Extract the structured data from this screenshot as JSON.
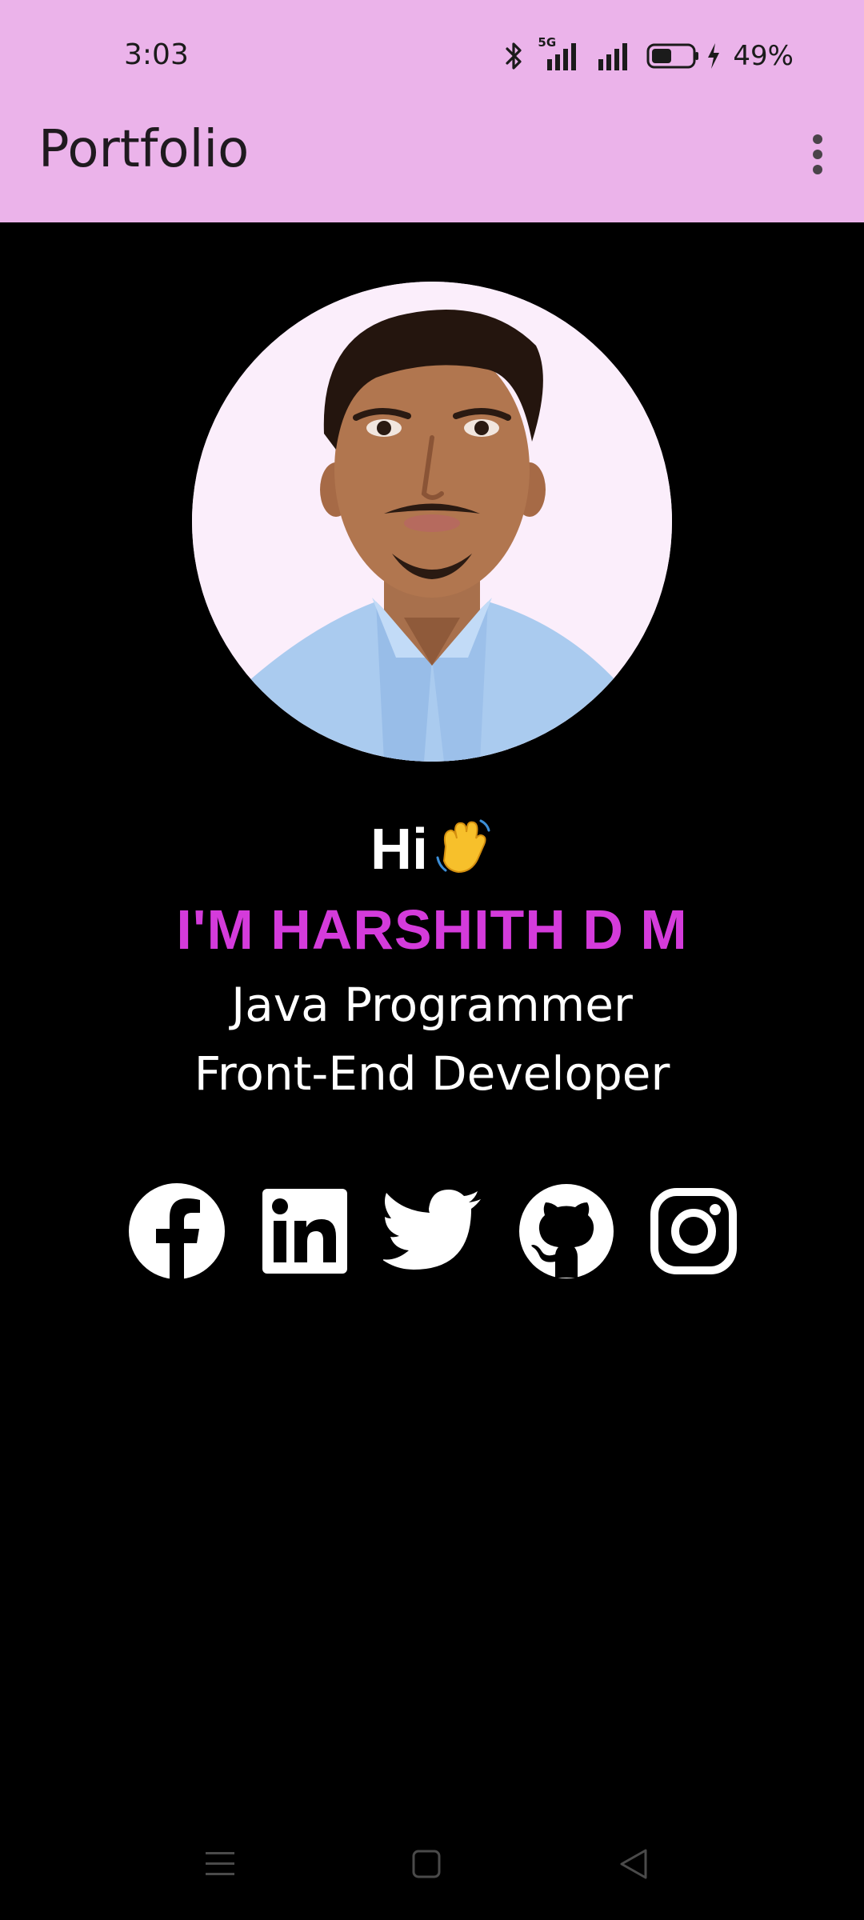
{
  "status_bar": {
    "time": "3:03",
    "battery_percent": "49%",
    "network_label": "5G",
    "battery_level": 0.49,
    "icons": [
      "bluetooth-icon",
      "signal-5g-icon",
      "signal-icon",
      "battery-icon",
      "charging-icon"
    ]
  },
  "app_bar": {
    "title": "Portfolio",
    "menu_icon": "more-vert-icon"
  },
  "profile": {
    "greeting": "Hi",
    "greeting_emoji": "waving-hand-icon",
    "name": "I'M HARSHITH D M",
    "roles": [
      "Java Programmer",
      "Front-End Developer"
    ]
  },
  "social_links": [
    "facebook-icon",
    "linkedin-icon",
    "twitter-icon",
    "github-icon",
    "instagram-icon"
  ],
  "nav_bar": [
    "menu-icon",
    "home-icon",
    "back-icon"
  ],
  "colors": {
    "app_bar_bg": "#ebb3ea",
    "background": "#000000",
    "name_accent": "#d43bdb",
    "text_primary": "#ffffff"
  }
}
